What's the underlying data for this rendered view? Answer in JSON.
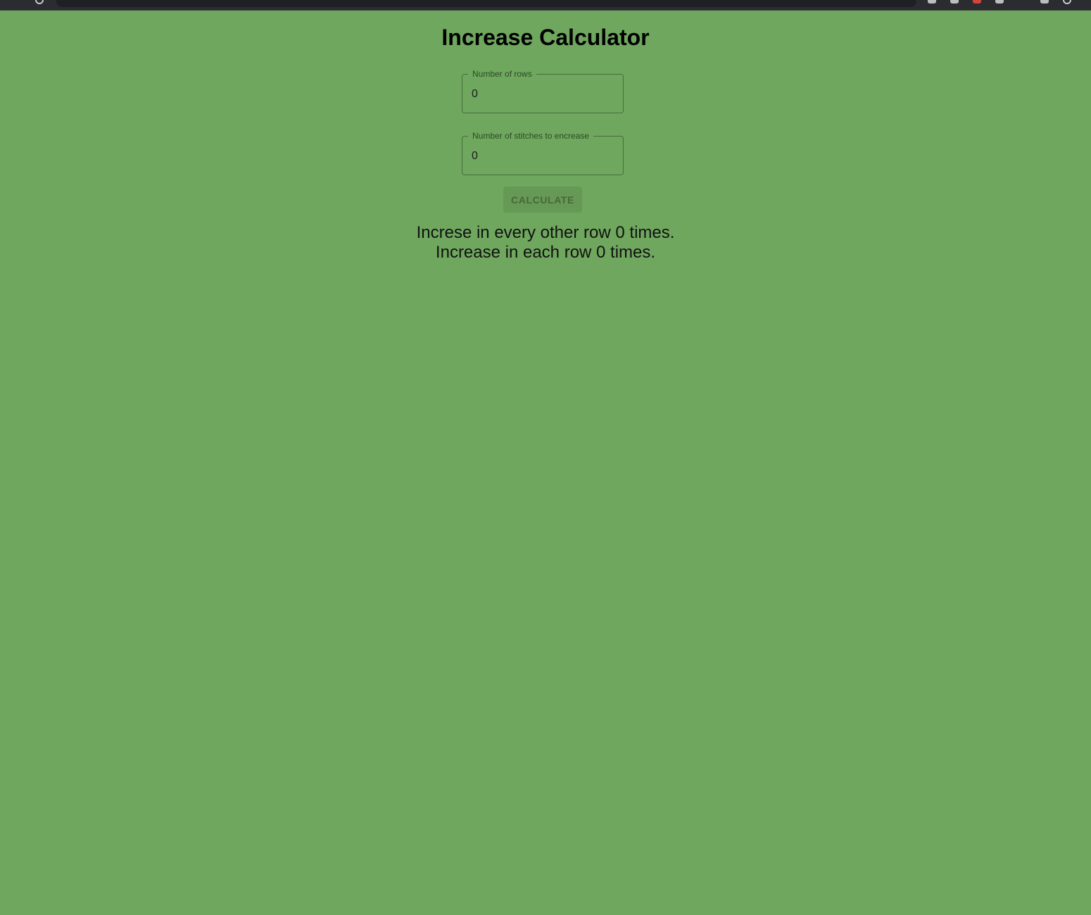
{
  "page": {
    "background_color": "#6fa75e",
    "title": "Increase Calculator"
  },
  "form": {
    "rows_field": {
      "label": "Number of rows",
      "value": "0"
    },
    "stitches_field": {
      "label": "Number of stitches to encrease",
      "value": "0"
    },
    "calculate_label": "CALCULATE",
    "calculate_disabled": true
  },
  "results": {
    "every_other_row": "Increse in every other row 0 times.",
    "each_row": "Increase in each row 0 times."
  }
}
